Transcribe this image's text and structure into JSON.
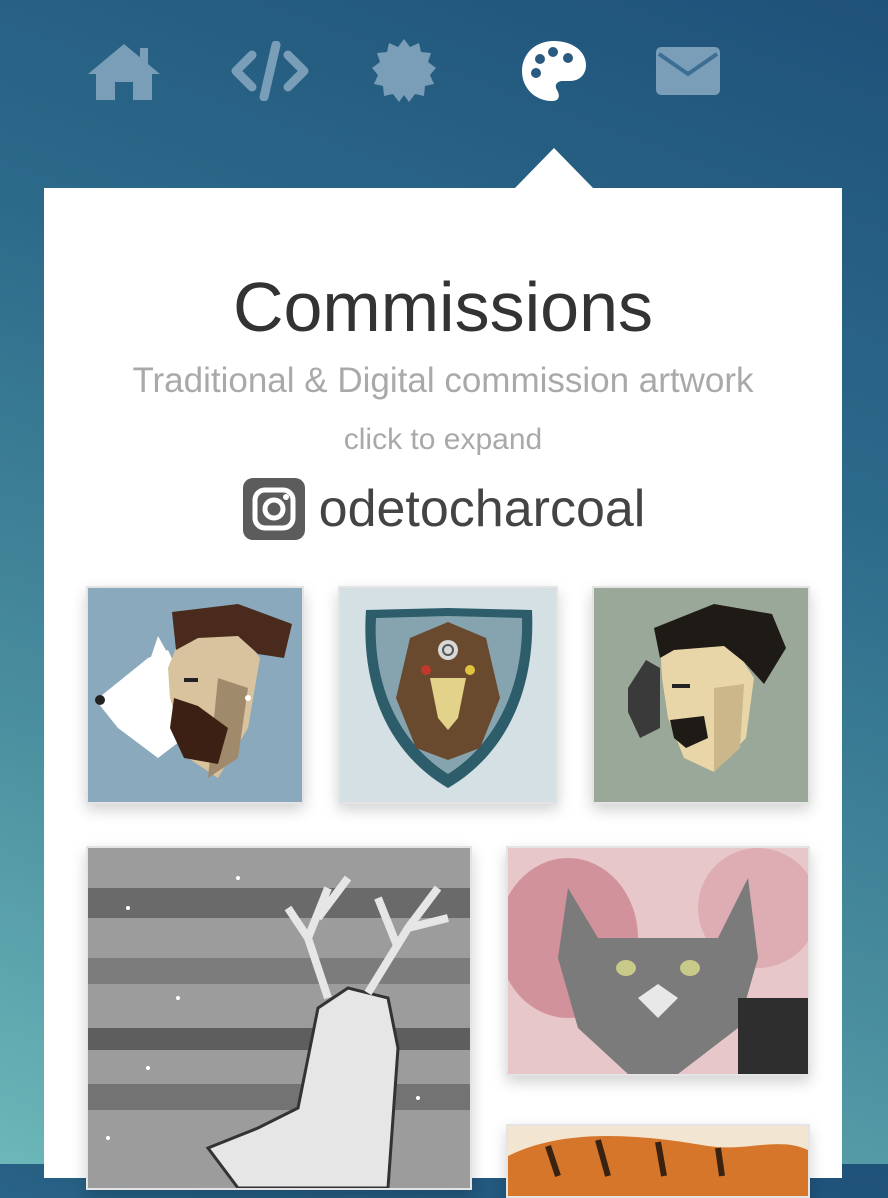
{
  "nav": {
    "items": [
      {
        "icon": "home-icon",
        "active": false
      },
      {
        "icon": "code-icon",
        "active": false
      },
      {
        "icon": "badge-icon",
        "active": false
      },
      {
        "icon": "palette-icon",
        "active": true
      },
      {
        "icon": "envelope-icon",
        "active": false
      }
    ],
    "colors": {
      "inactive": "#7a9db8",
      "active": "#ffffff"
    }
  },
  "section": {
    "title": "Commissions",
    "subtitle": "Traditional & Digital commission artwork",
    "hint": "click to expand"
  },
  "instagram": {
    "icon": "instagram-icon",
    "handle": "odetocharcoal"
  },
  "gallery": [
    {
      "name": "portrait-man-with-white-dog",
      "kind": "digital"
    },
    {
      "name": "eagle-shield-emblem",
      "kind": "digital"
    },
    {
      "name": "portrait-man-with-cat",
      "kind": "digital"
    },
    {
      "name": "white-stag-painting",
      "kind": "traditional"
    },
    {
      "name": "grey-cat-watercolor",
      "kind": "traditional"
    },
    {
      "name": "tiger-painting",
      "kind": "traditional"
    }
  ]
}
